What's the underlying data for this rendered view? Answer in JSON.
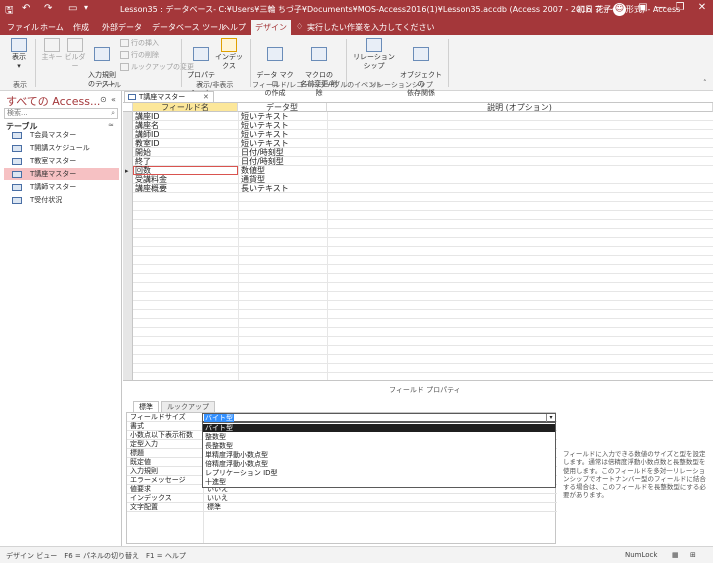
{
  "titlebar": {
    "title": "Lesson35 : データベース- C:¥Users¥三輪 ちづ子¥Documents¥MOS-Access2016(1)¥Lesson35.accdb (Access 2007 - 2016 ファイル形式) - Access",
    "user": "初日 花子",
    "avatar_glyph": "☺"
  },
  "menu": {
    "tabs": [
      "ファイル",
      "ホーム",
      "作成",
      "外部データ",
      "データベース ツール",
      "ヘルプ",
      "デザイン"
    ],
    "search": "実行したい作業を入力してください"
  },
  "ribbon": {
    "view": "表示",
    "primary_key": "主キー",
    "builder": "ビルダー",
    "test_rules": "入力規則\nのテスト",
    "insert_rows": "行の挿入",
    "delete_rows": "行の削除",
    "modify_lookups": "ルックアップの変更",
    "property_sheet": "プロパティ\nシート",
    "indexes": "インデックス",
    "create_macros": "データ マクロ\nの作成",
    "rename_macro": "マクロの\n名前変更/削除",
    "relationships": "リレーションシップ",
    "dependencies": "オブジェクトの\n依存関係",
    "groups": {
      "views": "表示",
      "tools": "ツール",
      "show_hide": "表示/非表示",
      "events": "フィールド/レコード/テーブルのイベント",
      "relations": "リレーションシップ"
    }
  },
  "nav": {
    "header": "すべての Access...",
    "search_placeholder": "検索...",
    "category": "テーブル",
    "items": [
      "T会員マスター",
      "T開講スケジュール",
      "T教室マスター",
      "T講座マスター",
      "T講師マスター",
      "T受付状況"
    ],
    "selected": "T講座マスター"
  },
  "doc_tab": {
    "label": "T講座マスター"
  },
  "grid": {
    "headers": {
      "field": "フィールド名",
      "type": "データ型",
      "desc": "説明 (オプション)"
    },
    "rows": [
      {
        "field": "講座ID",
        "type": "短いテキスト"
      },
      {
        "field": "講座名",
        "type": "短いテキスト"
      },
      {
        "field": "講師ID",
        "type": "短いテキスト"
      },
      {
        "field": "教室ID",
        "type": "短いテキスト"
      },
      {
        "field": "開始",
        "type": "日付/時刻型"
      },
      {
        "field": "終了",
        "type": "日付/時刻型"
      },
      {
        "field": "回数",
        "type": "数値型"
      },
      {
        "field": "受講料金",
        "type": "通貨型"
      },
      {
        "field": "講座概要",
        "type": "長いテキスト"
      }
    ]
  },
  "props": {
    "section_label": "フィールド プロパティ",
    "tab_general": "標準",
    "tab_lookup": "ルックアップ",
    "rows": [
      {
        "label": "フィールドサイズ",
        "value": ""
      },
      {
        "label": "書式",
        "value": ""
      },
      {
        "label": "小数点以下表示桁数",
        "value": ""
      },
      {
        "label": "定型入力",
        "value": ""
      },
      {
        "label": "標題",
        "value": ""
      },
      {
        "label": "既定値",
        "value": ""
      },
      {
        "label": "入力規則",
        "value": ""
      },
      {
        "label": "エラーメッセージ",
        "value": ""
      },
      {
        "label": "値要求",
        "value": "いいえ"
      },
      {
        "label": "インデックス",
        "value": "いいえ"
      },
      {
        "label": "文字配置",
        "value": "標準"
      }
    ],
    "dropdown_value": "バイト型",
    "options": [
      "バイト型",
      "整数型",
      "長整数型",
      "単精度浮動小数点型",
      "倍精度浮動小数点型",
      "レプリケーション ID型",
      "十進型"
    ],
    "help": "フィールドに入力できる数値のサイズと型を設定します。通常は倍精度浮動小数点数と長整数型を使用します。このフィールドを多対一リレーションシップでオートナンバー型のフィールドに結合する場合は、このフィールドを長整数型にする必要があります。"
  },
  "status": {
    "left": "デザイン ビュー　F6 = パネルの切り替え　F1 = ヘルプ",
    "numlock": "NumLock"
  }
}
